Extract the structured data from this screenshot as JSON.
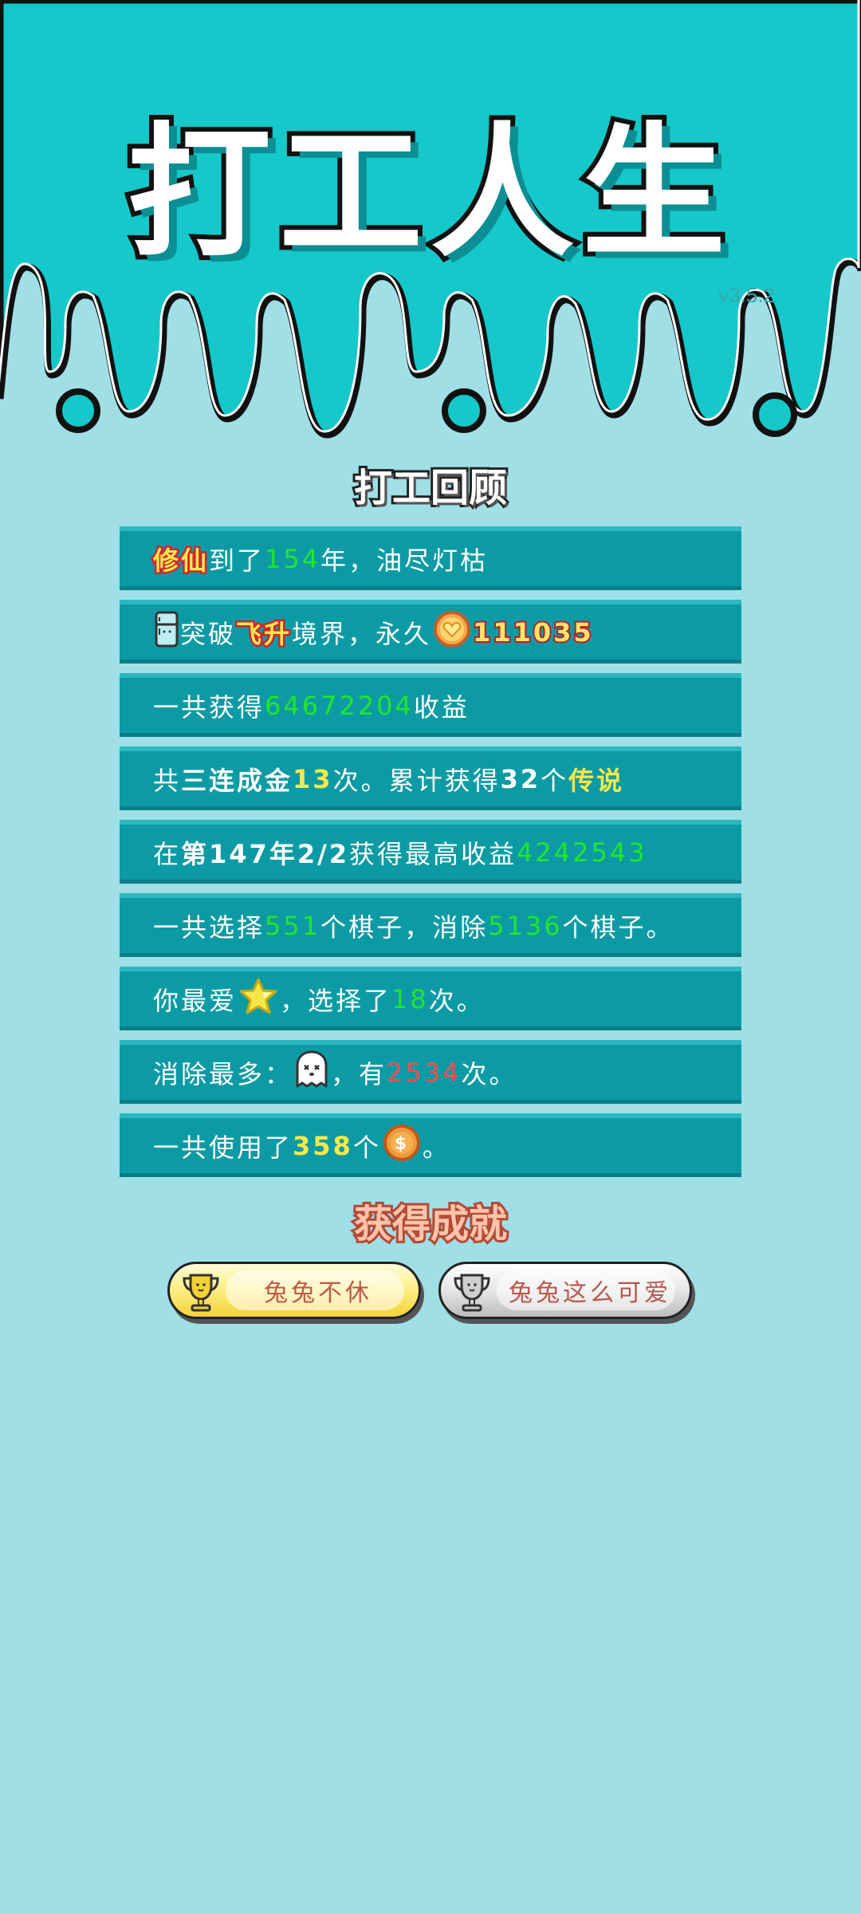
{
  "header": {
    "title": "打工人生",
    "version": "v3.5.2"
  },
  "review": {
    "title": "打工回顾",
    "rows": [
      {
        "a": "修仙",
        "b": "到了",
        "c": "154",
        "d": "年，油尽灯枯"
      },
      {
        "icon": "fridge-icon",
        "a": "突破",
        "b": "飞升",
        "c": "境界，永久",
        "icon2": "heart-coin-icon",
        "d": "111035"
      },
      {
        "a": "一共获得",
        "b": "64672204",
        "c": "收益"
      },
      {
        "a": "共",
        "b": "三连成金",
        "c": "13",
        "d": "次。累计获得",
        "e": "32",
        "f": "个",
        "g": "传说"
      },
      {
        "a": "在 ",
        "b": "第147年2/2",
        "c": " 获得最高收益",
        "d": "4242543"
      },
      {
        "a": "一共选择",
        "b": "551",
        "c": "个棋子，消除",
        "d": "5136",
        "e": "个棋子。"
      },
      {
        "a": "你最爱",
        "icon": "star-icon",
        "b": "，选择了",
        "c": "18",
        "d": "次。"
      },
      {
        "a": "消除最多：",
        "icon": "ghost-icon",
        "b": "，有",
        "c": "2534",
        "d": "次。"
      },
      {
        "a": "一共使用了",
        "b": "358",
        "c": "个",
        "icon": "coin-icon",
        "d": "。"
      }
    ]
  },
  "achievements": {
    "title": "获得成就",
    "items": [
      {
        "label": "兔兔不休",
        "tier": "gold"
      },
      {
        "label": "兔兔这么可爱",
        "tier": "silver"
      }
    ]
  },
  "colors": {
    "background": "#a0dfe6",
    "header": "#15c8c9",
    "row": "#0c9ba5",
    "highlight_green": "#22e62a",
    "highlight_yellow": "#fbe84a"
  }
}
